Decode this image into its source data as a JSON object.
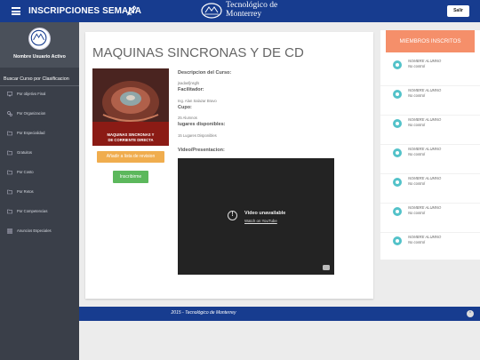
{
  "header": {
    "title": "INSCRIPCIONES SEMANA",
    "logo_line1": "Tecnológico de",
    "logo_line2": "Monterrey",
    "exit_label": "Salir"
  },
  "sidebar": {
    "user_name": "Nombre Usuario Activo",
    "heading": "Buscar Curso por Clasificacion",
    "items": [
      {
        "label": "Por objetivo Final",
        "icon": "monitor-icon"
      },
      {
        "label": "Por Organizacion",
        "icon": "cogs-icon"
      },
      {
        "label": "Por Especialidad",
        "icon": "folder-icon"
      },
      {
        "label": "Gratuitos",
        "icon": "folder-icon"
      },
      {
        "label": "Por Costo",
        "icon": "folder-icon"
      },
      {
        "label": "Por Retos",
        "icon": "folder-icon"
      },
      {
        "label": "Por Competencias",
        "icon": "folder-icon"
      },
      {
        "label": "Anuncios Especiales",
        "icon": "grid-icon"
      }
    ]
  },
  "course": {
    "title": "MAQUINAS SINCRONAS Y DE CD",
    "image_caption_line1": "MAQUINAS SINCRONAS Y",
    "image_caption_line2": "DE CORRIENTE DIRECTA",
    "add_button": "Añadir a lista de revision",
    "enroll_button": "Inscribirme",
    "description_label": "Descripcion del Curso:",
    "description_value": "jsadasfjnsgfs",
    "facilitator_label": "Facilitador:",
    "facilitator_value": "Ing. Alan Salazar Bravo",
    "quota_label": "Cupo:",
    "quota_value": "25 Alumnos",
    "available_label": "lugares disponibles:",
    "available_value": "15 Lugares Disponibles",
    "video_label": "Video/Presentacion:",
    "video_unavailable": "Video unavailable",
    "video_link": "Watch on YouTube"
  },
  "members": {
    "header": "MIEMBROS INSCRITOS",
    "list": [
      {
        "name": "NOMBRE ALUMNO",
        "meta": "No control"
      },
      {
        "name": "NOMBRE ALUMNO",
        "meta": "No control"
      },
      {
        "name": "NOMBRE ALUMNO",
        "meta": "No control"
      },
      {
        "name": "NOMBRE ALUMNO",
        "meta": "No control"
      },
      {
        "name": "NOMBRE ALUMNO",
        "meta": "No control"
      },
      {
        "name": "NOMBRE ALUMNO",
        "meta": "No control"
      },
      {
        "name": "NOMBRE ALUMNO",
        "meta": "No control"
      }
    ]
  },
  "footer": {
    "text": "2015 - Tecnológico de Monterrey"
  },
  "colors": {
    "primary": "#173c8f",
    "sidebar": "#3a3f49",
    "accent_orange": "#f0ad4e",
    "accent_green": "#5cb85c",
    "members_header": "#f58f6a",
    "member_avatar": "#53c2c9"
  }
}
